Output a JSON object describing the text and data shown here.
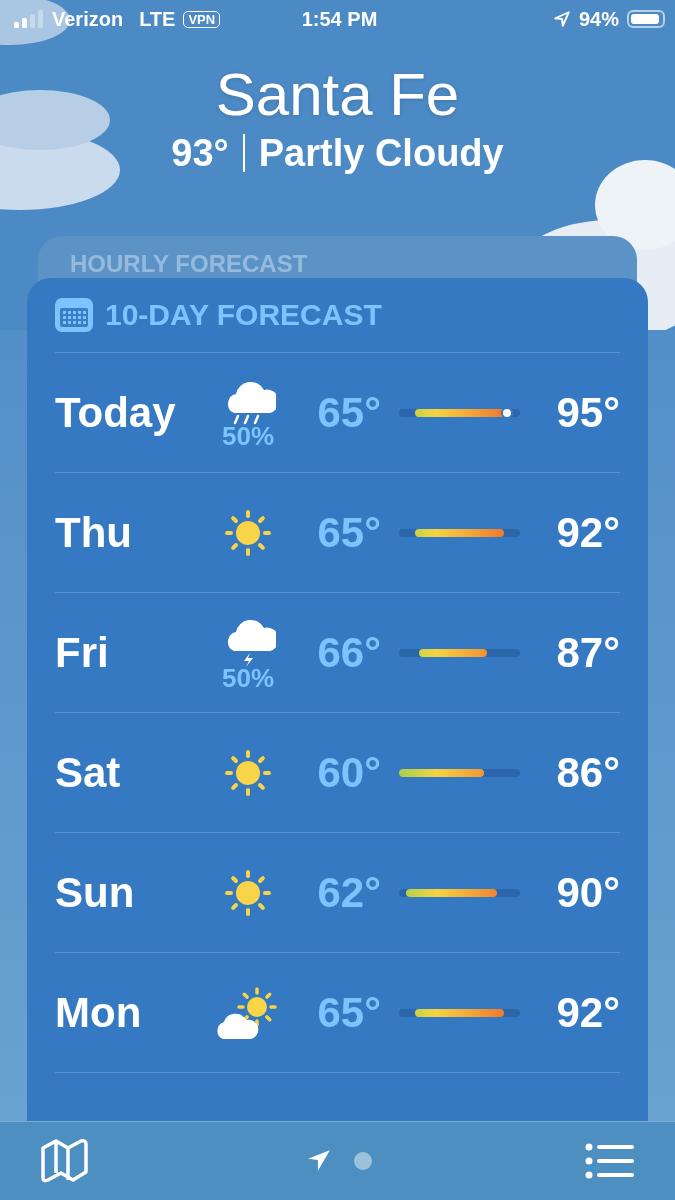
{
  "status_bar": {
    "carrier": "Verizon",
    "network": "LTE",
    "vpn": "VPN",
    "time": "1:54 PM",
    "battery": "94%"
  },
  "location": {
    "city": "Santa Fe",
    "temperature": "93°",
    "condition": "Partly Cloudy"
  },
  "hourly_forecast": {
    "title": "HOURLY FORECAST"
  },
  "ten_day_forecast": {
    "title": "10-DAY FORECAST",
    "days": [
      {
        "day": "Today",
        "kind": "rain",
        "precipitation": "50%",
        "low": "65°",
        "high": "95°",
        "shows_current": true
      },
      {
        "day": "Thu",
        "kind": "sun",
        "low": "65°",
        "high": "92°",
        "shows_current": false
      },
      {
        "day": "Fri",
        "kind": "thunder",
        "precipitation": "50%",
        "low": "66°",
        "high": "87°",
        "shows_current": false
      },
      {
        "day": "Sat",
        "kind": "sun",
        "low": "60°",
        "high": "86°",
        "shows_current": false
      },
      {
        "day": "Sun",
        "kind": "sun",
        "low": "62°",
        "high": "90°",
        "shows_current": false
      },
      {
        "day": "Mon",
        "kind": "partly-sunny",
        "low": "65°",
        "high": "92°",
        "shows_current": false
      }
    ]
  },
  "toolbar": {
    "pages": [
      {
        "kind": "location",
        "selected": true
      },
      {
        "kind": "dot",
        "selected": false
      }
    ]
  }
}
